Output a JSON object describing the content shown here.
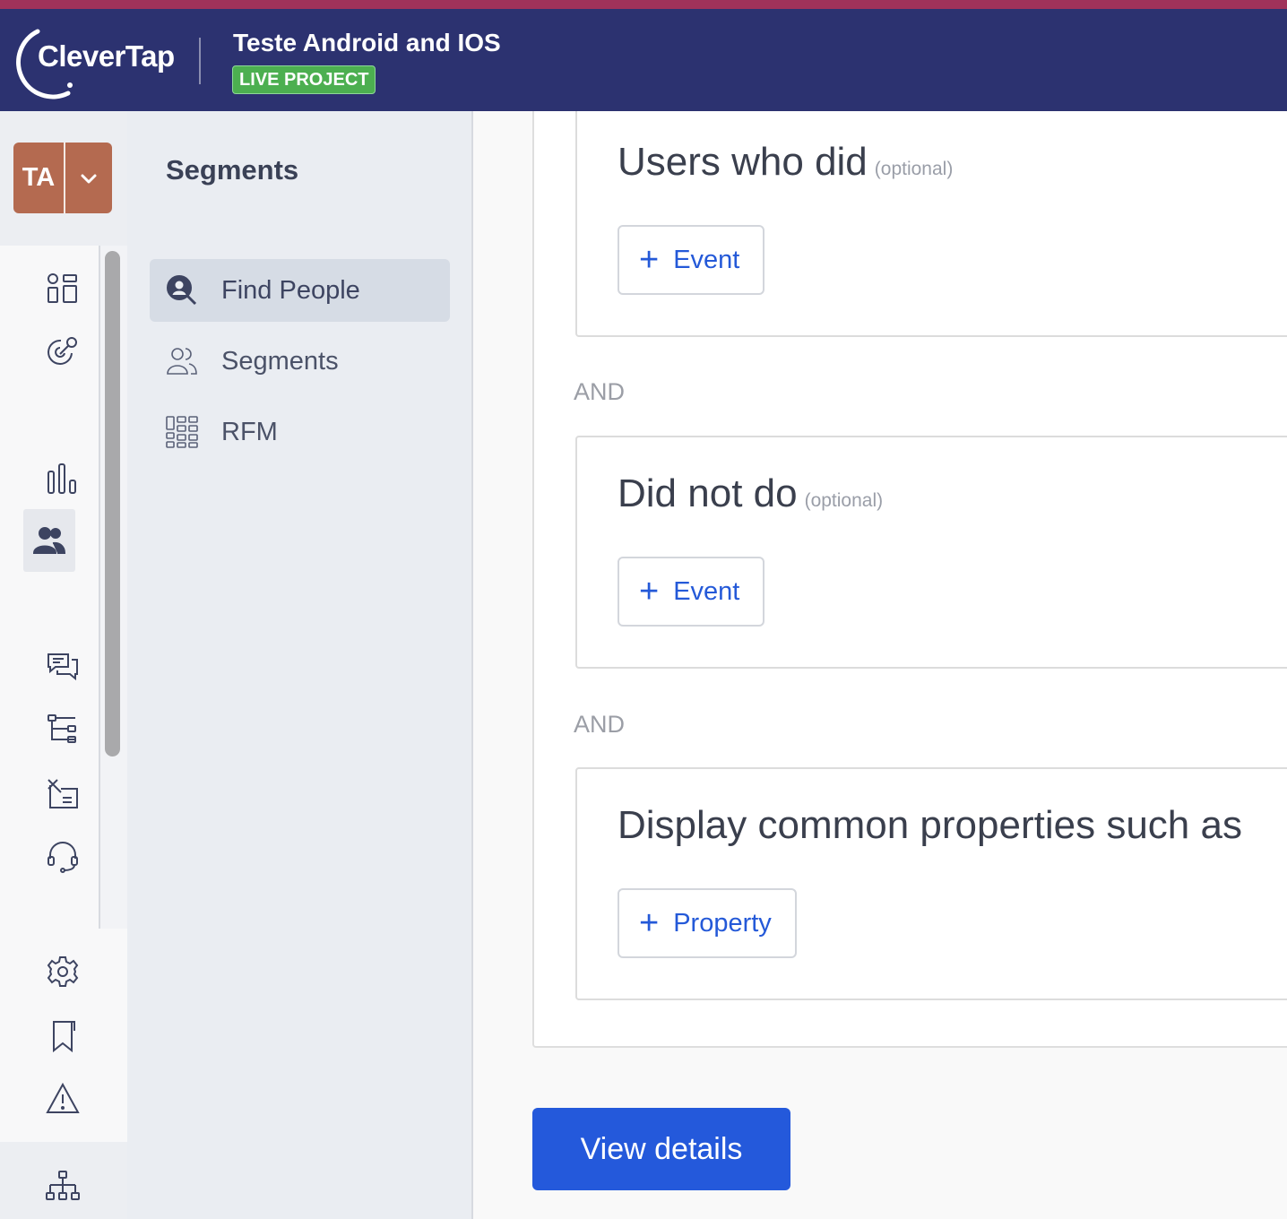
{
  "header": {
    "logo_text": "CleverTap",
    "project_title": "Teste Android and IOS",
    "project_badge": "LIVE PROJECT",
    "brand_color": "#2c3270",
    "accent_stripe": "#a0325a"
  },
  "account": {
    "initials": "TA",
    "avatar_color": "#b46a50"
  },
  "rail": {
    "icons": [
      "dashboard-icon",
      "campaign-target-icon",
      "analytics-icon",
      "segments-icon",
      "messages-icon",
      "journeys-icon",
      "catalog-icon",
      "support-icon",
      "settings-icon",
      "bookmark-icon",
      "alert-icon",
      "hierarchy-icon"
    ],
    "active": "segments-icon"
  },
  "subnav": {
    "title": "Segments",
    "items": [
      {
        "label": "Find People",
        "icon": "find-people-icon",
        "active": true
      },
      {
        "label": "Segments",
        "icon": "users-icon",
        "active": false
      },
      {
        "label": "RFM",
        "icon": "grid-icon",
        "active": false
      }
    ]
  },
  "main": {
    "sections": [
      {
        "title": "Users who did",
        "optional": "(optional)",
        "button": "Event"
      },
      {
        "title": "Did not do",
        "optional": "(optional)",
        "button": "Event"
      },
      {
        "title": "Display common properties such as",
        "optional": "",
        "button": "Property"
      }
    ],
    "connector": "AND",
    "view_details": "View details",
    "primary_color": "#2459db"
  }
}
